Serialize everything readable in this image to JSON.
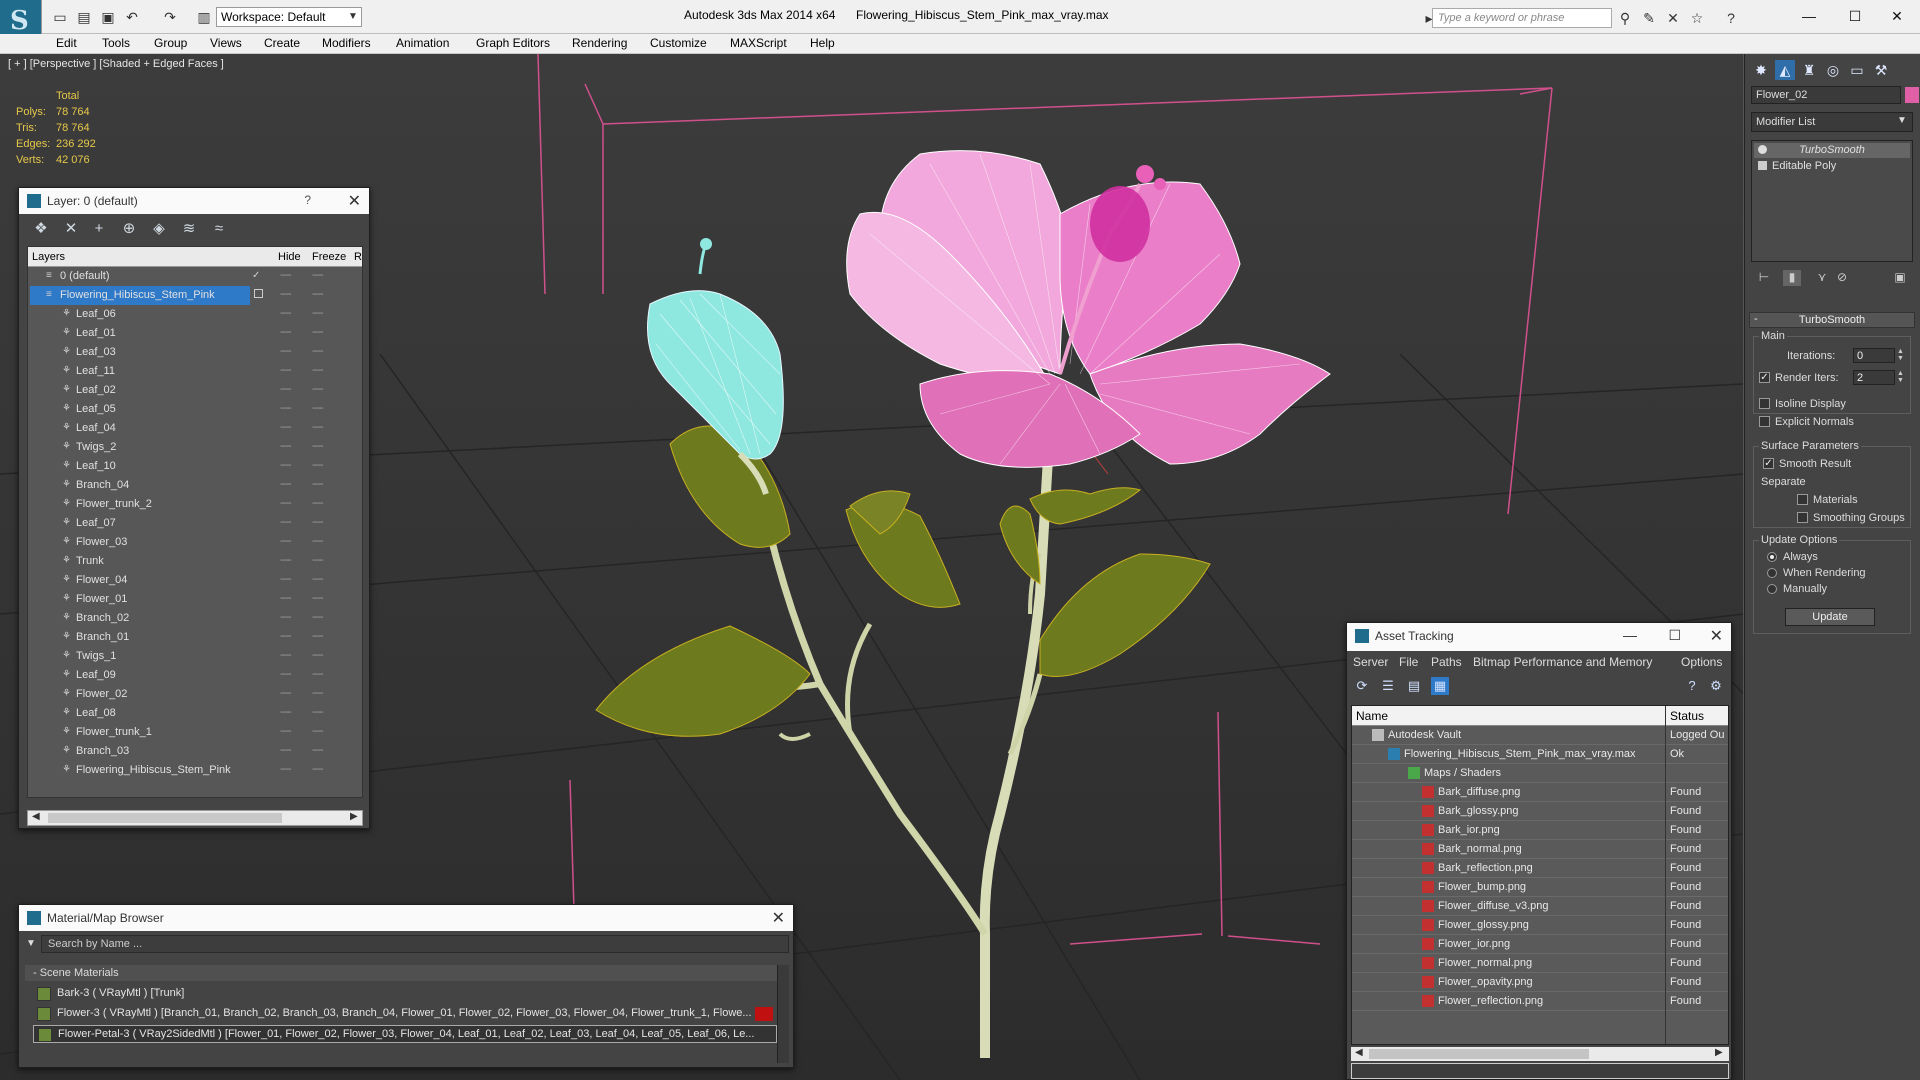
{
  "titlebar": {
    "workspace": "Workspace: Default",
    "app_title": "Autodesk 3ds Max  2014 x64",
    "file_title": "Flowering_Hibiscus_Stem_Pink_max_vray.max",
    "search_placeholder": "Type a keyword or phrase"
  },
  "menu": [
    "Edit",
    "Tools",
    "Group",
    "Views",
    "Create",
    "Modifiers",
    "Animation",
    "Graph Editors",
    "Rendering",
    "Customize",
    "MAXScript",
    "Help"
  ],
  "viewport": {
    "label": "[ + ] [Perspective ] [Shaded + Edged Faces ]",
    "stats": {
      "header": "Total",
      "polys_label": "Polys:",
      "polys": "78 764",
      "tris_label": "Tris:",
      "tris": "78 764",
      "edges_label": "Edges:",
      "edges": "236 292",
      "verts_label": "Verts:",
      "verts": "42 076"
    }
  },
  "layer_dialog": {
    "title": "Layer: 0 (default)",
    "help": "?",
    "columns": {
      "layers": "Layers",
      "hide": "Hide",
      "freeze": "Freeze",
      "render": "Re"
    },
    "rows": [
      {
        "name": "0 (default)",
        "level": 0
      },
      {
        "name": "Flowering_Hibiscus_Stem_Pink",
        "level": 0
      },
      {
        "name": "Leaf_06",
        "level": 1
      },
      {
        "name": "Leaf_01",
        "level": 1
      },
      {
        "name": "Leaf_03",
        "level": 1
      },
      {
        "name": "Leaf_11",
        "level": 1
      },
      {
        "name": "Leaf_02",
        "level": 1
      },
      {
        "name": "Leaf_05",
        "level": 1
      },
      {
        "name": "Leaf_04",
        "level": 1
      },
      {
        "name": "Twigs_2",
        "level": 1
      },
      {
        "name": "Leaf_10",
        "level": 1
      },
      {
        "name": "Branch_04",
        "level": 1
      },
      {
        "name": "Flower_trunk_2",
        "level": 1
      },
      {
        "name": "Leaf_07",
        "level": 1
      },
      {
        "name": "Flower_03",
        "level": 1
      },
      {
        "name": "Trunk",
        "level": 1
      },
      {
        "name": "Flower_04",
        "level": 1
      },
      {
        "name": "Flower_01",
        "level": 1
      },
      {
        "name": "Branch_02",
        "level": 1
      },
      {
        "name": "Branch_01",
        "level": 1
      },
      {
        "name": "Twigs_1",
        "level": 1
      },
      {
        "name": "Leaf_09",
        "level": 1
      },
      {
        "name": "Flower_02",
        "level": 1
      },
      {
        "name": "Leaf_08",
        "level": 1
      },
      {
        "name": "Flower_trunk_1",
        "level": 1
      },
      {
        "name": "Branch_03",
        "level": 1
      },
      {
        "name": "Flowering_Hibiscus_Stem_Pink",
        "level": 1
      }
    ],
    "dash": "----"
  },
  "material_browser": {
    "title": "Material/Map Browser",
    "search_placeholder": "Search by Name ...",
    "section": "- Scene Materials",
    "rows": [
      "Bark-3  ( VRayMtl )  [Trunk]",
      "Flower-3  ( VRayMtl )  [Branch_01, Branch_02, Branch_03, Branch_04, Flower_01, Flower_02, Flower_03, Flower_04, Flower_trunk_1, Flowe...",
      "Flower-Petal-3  ( VRay2SidedMtl )  [Flower_01, Flower_02, Flower_03, Flower_04, Leaf_01, Leaf_02, Leaf_03, Leaf_04, Leaf_05, Leaf_06, Le..."
    ]
  },
  "asset_tracking": {
    "title": "Asset Tracking",
    "menu": [
      "Server",
      "File",
      "Paths",
      "Bitmap Performance and Memory",
      "Options"
    ],
    "columns": {
      "name": "Name",
      "status": "Status"
    },
    "rows": [
      {
        "name": "Autodesk Vault",
        "status": "Logged Ou",
        "type": "vault",
        "level": 0
      },
      {
        "name": "Flowering_Hibiscus_Stem_Pink_max_vray.max",
        "status": "Ok",
        "type": "max",
        "level": 1
      },
      {
        "name": "Maps / Shaders",
        "status": "",
        "type": "folder",
        "level": 2
      },
      {
        "name": "Bark_diffuse.png",
        "status": "Found",
        "type": "png",
        "level": 3
      },
      {
        "name": "Bark_glossy.png",
        "status": "Found",
        "type": "png",
        "level": 3
      },
      {
        "name": "Bark_ior.png",
        "status": "Found",
        "type": "png",
        "level": 3
      },
      {
        "name": "Bark_normal.png",
        "status": "Found",
        "type": "png",
        "level": 3
      },
      {
        "name": "Bark_reflection.png",
        "status": "Found",
        "type": "png",
        "level": 3
      },
      {
        "name": "Flower_bump.png",
        "status": "Found",
        "type": "png",
        "level": 3
      },
      {
        "name": "Flower_diffuse_v3.png",
        "status": "Found",
        "type": "png",
        "level": 3
      },
      {
        "name": "Flower_glossy.png",
        "status": "Found",
        "type": "png",
        "level": 3
      },
      {
        "name": "Flower_ior.png",
        "status": "Found",
        "type": "png",
        "level": 3
      },
      {
        "name": "Flower_normal.png",
        "status": "Found",
        "type": "png",
        "level": 3
      },
      {
        "name": "Flower_opavity.png",
        "status": "Found",
        "type": "png",
        "level": 3
      },
      {
        "name": "Flower_reflection.png",
        "status": "Found",
        "type": "png",
        "level": 3
      }
    ]
  },
  "command_panel": {
    "object_name": "Flower_02",
    "object_color": "#e060a8",
    "modifier_list": "Modifier List",
    "stack": [
      "TurboSmooth",
      "Editable Poly"
    ],
    "rollout_title": "TurboSmooth",
    "main_label": "Main",
    "iterations_label": "Iterations:",
    "iterations": "0",
    "render_iters_label": "Render Iters:",
    "render_iters": "2",
    "render_iters_checked": true,
    "isoline_label": "Isoline Display",
    "explicit_normals_label": "Explicit Normals",
    "surface_label": "Surface Parameters",
    "smooth_result_label": "Smooth Result",
    "separate_label": "Separate",
    "materials_label": "Materials",
    "smoothing_groups_label": "Smoothing Groups",
    "update_options_label": "Update Options",
    "always_label": "Always",
    "when_rendering_label": "When Rendering",
    "manually_label": "Manually",
    "update_button": "Update"
  },
  "colors": {
    "selection": "#2f79c9",
    "petal_pink": "#e77bc2",
    "bud_cyan": "#8fe8e0",
    "leaf": "#6e7a1e",
    "stats_yellow": "#e6c84a"
  }
}
